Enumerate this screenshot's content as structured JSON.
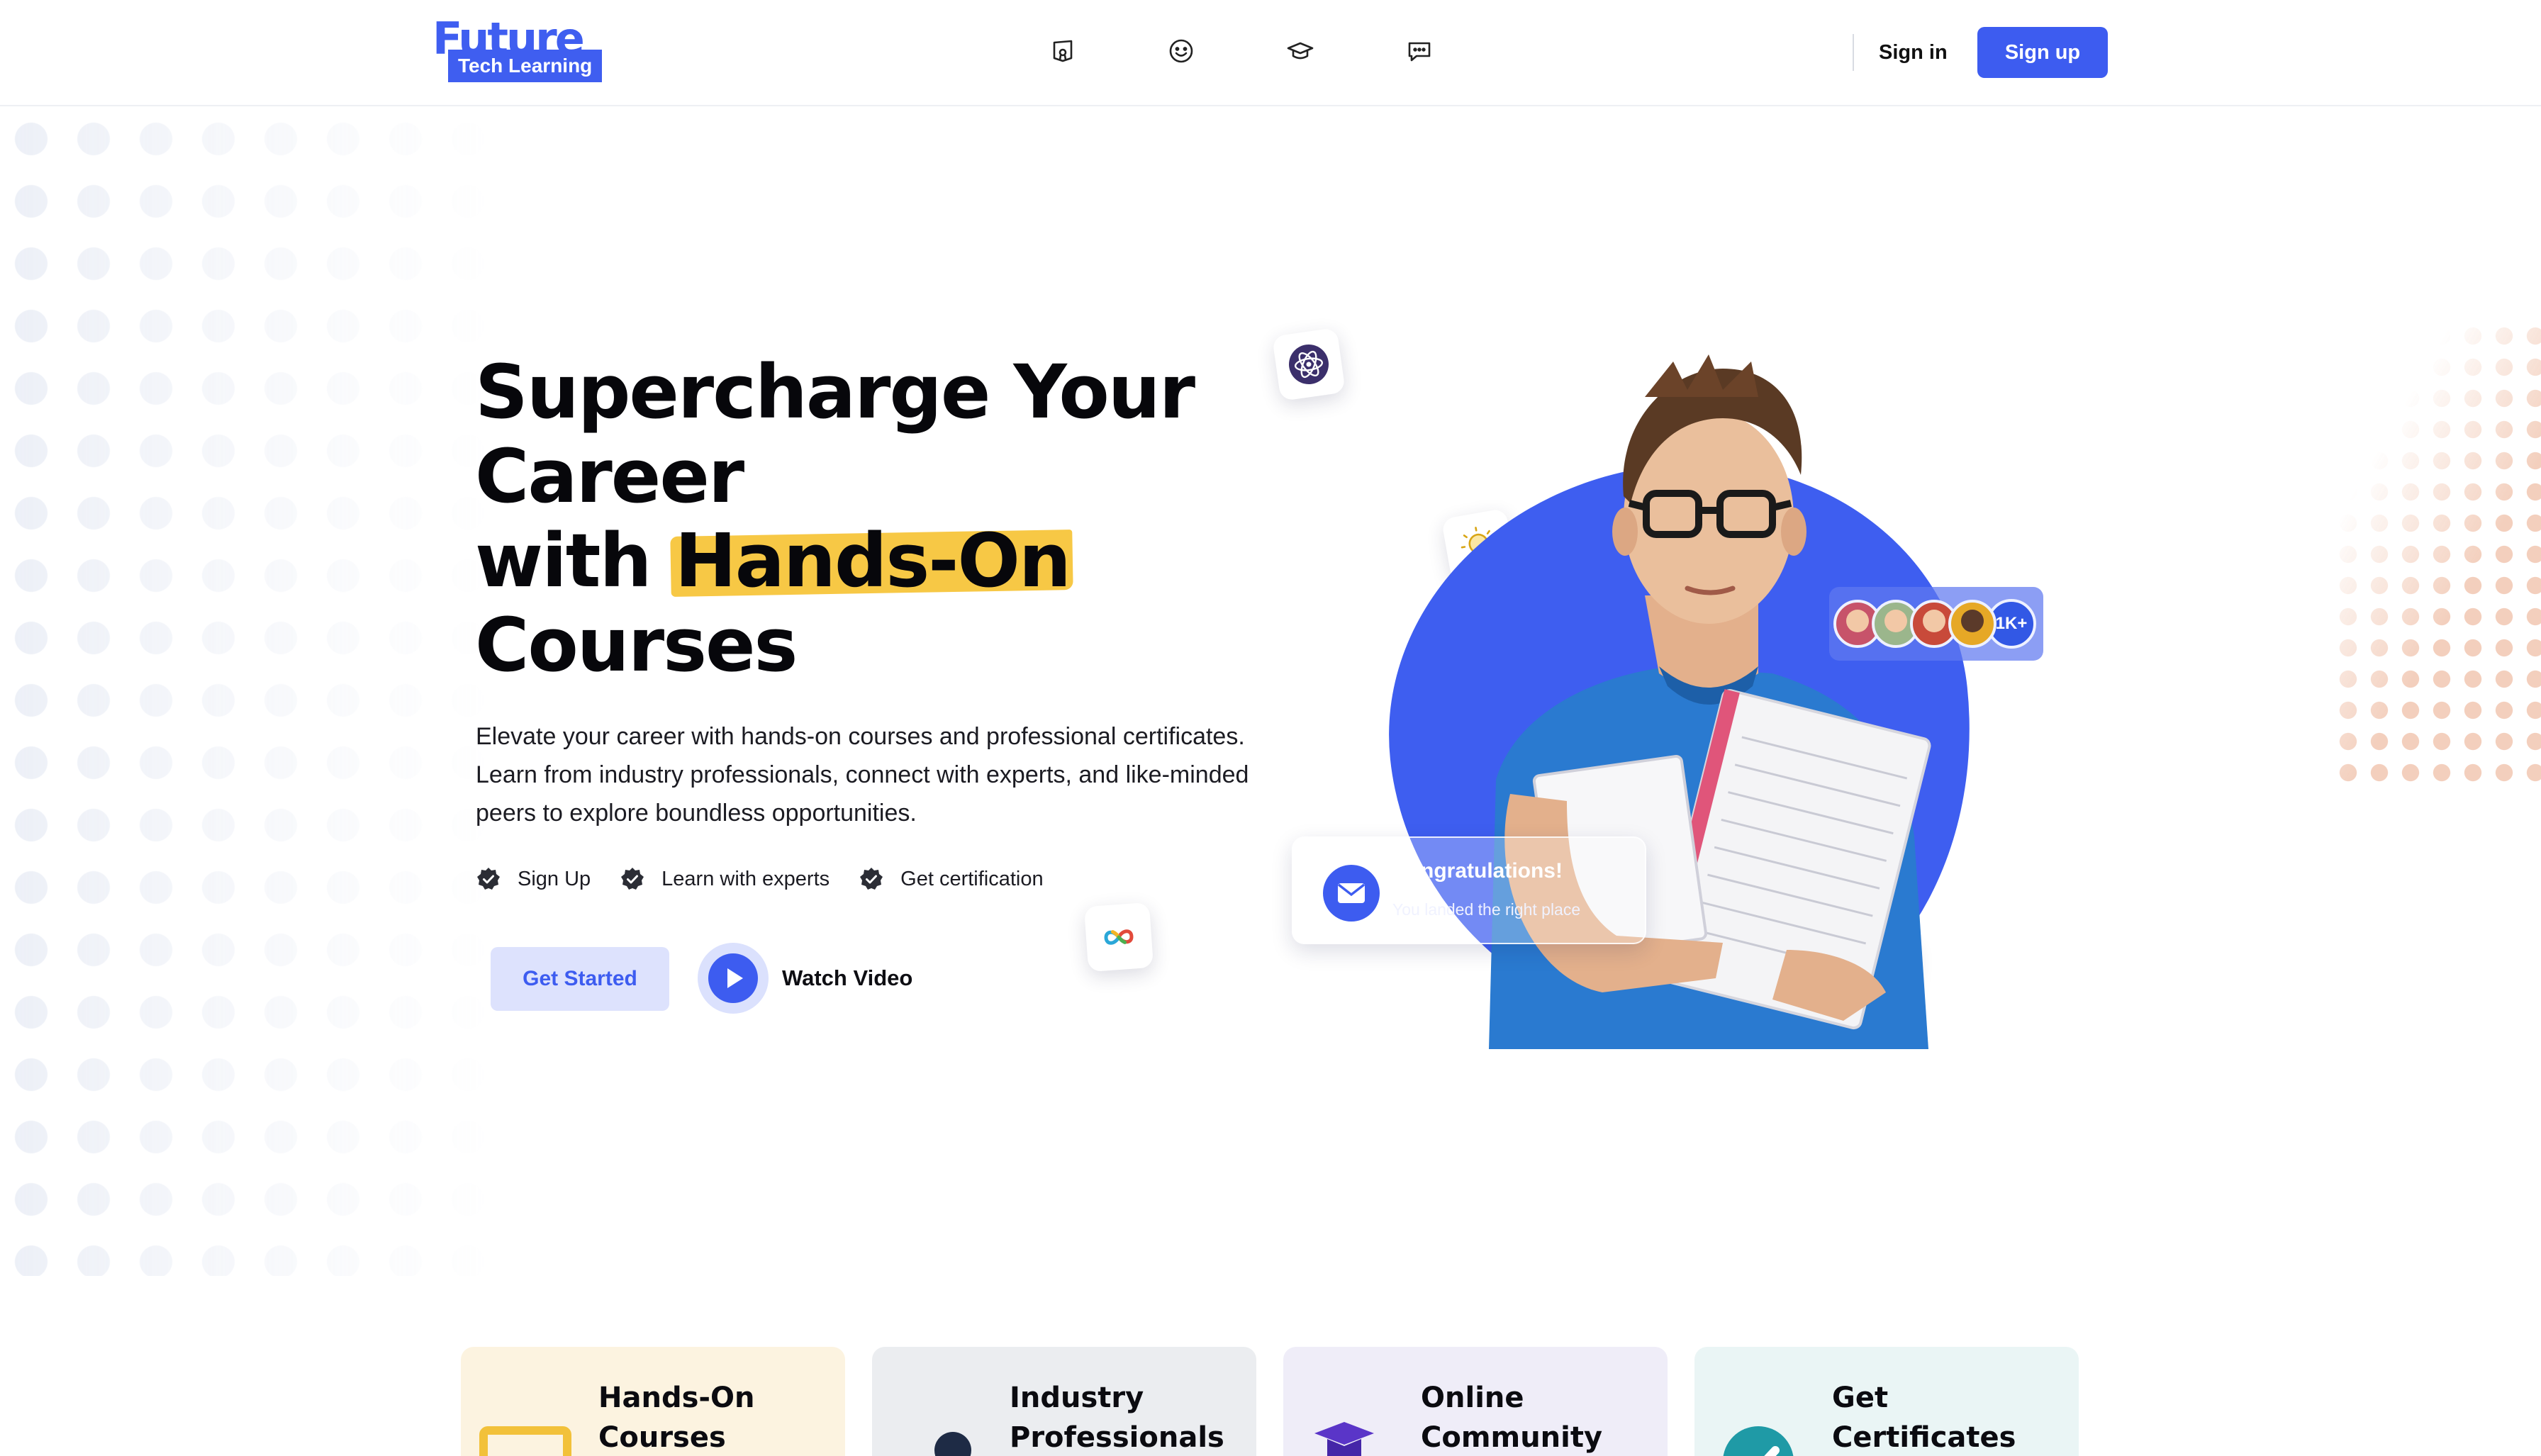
{
  "brand": {
    "logo_word": "Future",
    "logo_tag": "Tech Learning",
    "accent": "#3d5cf0",
    "highlight": "#f7c845"
  },
  "nav": {
    "icons": [
      "book-badge-icon",
      "smiley-icon",
      "graduation-cap-icon",
      "chat-bubble-icon"
    ],
    "signin_label": "Sign in",
    "signup_label": "Sign up"
  },
  "hero": {
    "headline_line1": "Supercharge Your",
    "headline_line2": "Career",
    "headline_line3_pre": "with",
    "headline_highlight": "Hands-On",
    "headline_line4": "Courses",
    "description": "Elevate your career with hands-on courses and professional certificates. Learn from industry professionals, connect with experts, and like-minded peers to explore boundless opportunities.",
    "checks": [
      "Sign Up",
      "Learn with experts",
      "Get certification"
    ],
    "cta_primary": "Get Started",
    "cta_video": "Watch Video"
  },
  "floating": {
    "tiles": [
      "atom-icon",
      "lightbulb-icon",
      "infinity-logo-icon",
      "figma-logo-icon"
    ],
    "avatars_count": "1K+",
    "congrats_title": "Congratulations!",
    "congrats_subtitle": "You landed the right place"
  },
  "features": [
    {
      "title": "Hands-On Courses",
      "bg": "#fcf3e0"
    },
    {
      "title": "Industry Professionals",
      "bg": "#ebedf0"
    },
    {
      "title": "Online Community",
      "bg": "#efedf8"
    },
    {
      "title": "Get Certificates",
      "bg": "#eaf5f5"
    }
  ]
}
